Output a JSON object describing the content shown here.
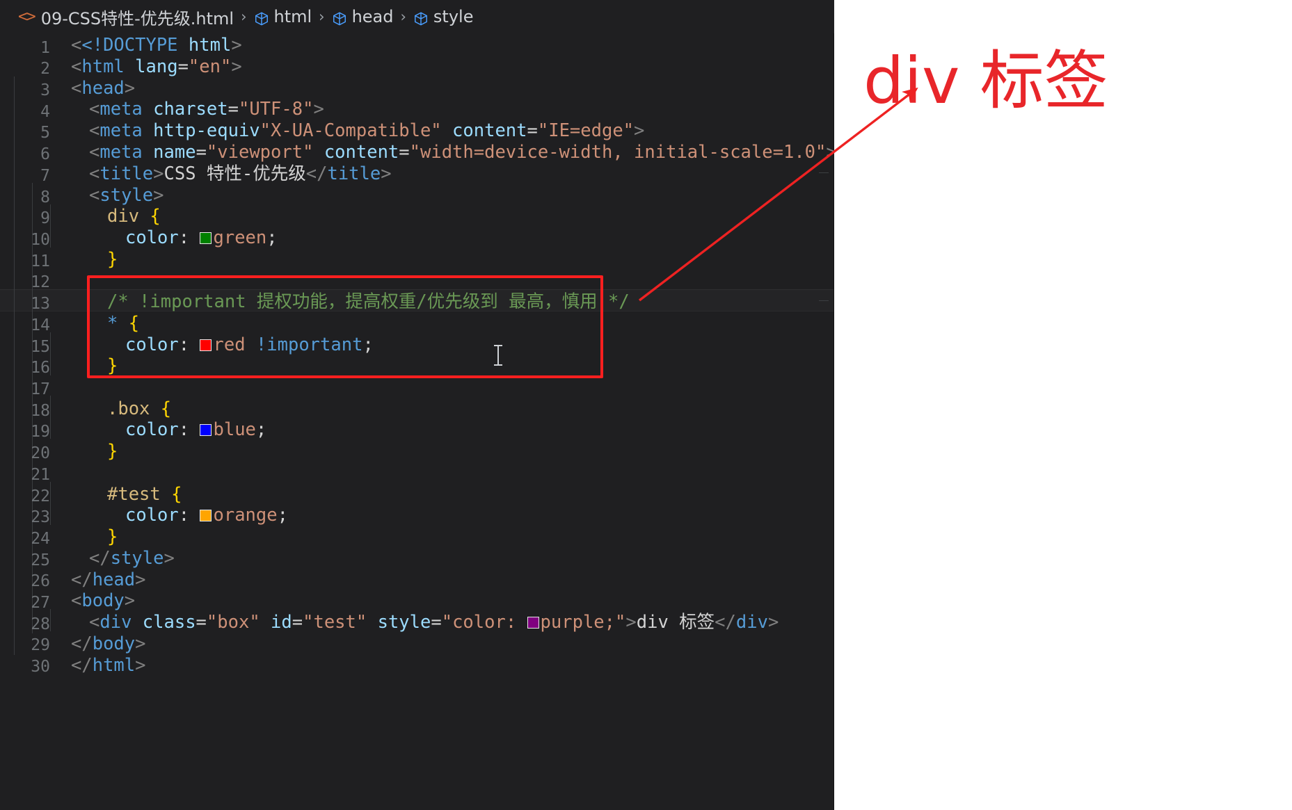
{
  "window": {
    "background": "#1f1f21",
    "accent_red": "#ff1f1f"
  },
  "breadcrumb": {
    "code_icon": "<>",
    "file_name": "09-CSS特性-优先级.html",
    "separator": "›",
    "items": [
      {
        "icon": "cube-icon",
        "label": "html"
      },
      {
        "icon": "cube-icon",
        "label": "head"
      },
      {
        "icon": "cube-icon",
        "label": "style"
      }
    ]
  },
  "editor": {
    "language": "html",
    "line_numbers": [
      1,
      2,
      3,
      4,
      5,
      6,
      7,
      8,
      9,
      10,
      11,
      12,
      13,
      14,
      15,
      16,
      17,
      18,
      19,
      20,
      21,
      22,
      23,
      24,
      25,
      26,
      27,
      28,
      29,
      30
    ],
    "lines": [
      {
        "n": 1,
        "text": "<!DOCTYPE html>"
      },
      {
        "n": 2,
        "text": "<html lang=\"en\">"
      },
      {
        "n": 3,
        "text": "<head>"
      },
      {
        "n": 4,
        "text": "  <meta charset=\"UTF-8\">"
      },
      {
        "n": 5,
        "text": "  <meta http-equiv=\"X-UA-Compatible\" content=\"IE=edge\">"
      },
      {
        "n": 6,
        "text": "  <meta name=\"viewport\" content=\"width=device-width, initial-scale=1.0\">"
      },
      {
        "n": 7,
        "text": "  <title>CSS 特性-优先级</title>"
      },
      {
        "n": 8,
        "text": "  <style>"
      },
      {
        "n": 9,
        "text": "    div {"
      },
      {
        "n": 10,
        "text": "      color: green;"
      },
      {
        "n": 11,
        "text": "    }"
      },
      {
        "n": 12,
        "text": ""
      },
      {
        "n": 13,
        "text": "    /* !important 提权功能，提高权重/优先级到 最高，慎用 */"
      },
      {
        "n": 14,
        "text": "    * {"
      },
      {
        "n": 15,
        "text": "      color: red !important;"
      },
      {
        "n": 16,
        "text": "    }"
      },
      {
        "n": 17,
        "text": ""
      },
      {
        "n": 18,
        "text": "    .box {"
      },
      {
        "n": 19,
        "text": "      color: blue;"
      },
      {
        "n": 20,
        "text": "    }"
      },
      {
        "n": 21,
        "text": ""
      },
      {
        "n": 22,
        "text": "    #test {"
      },
      {
        "n": 23,
        "text": "      color: orange;"
      },
      {
        "n": 24,
        "text": "    }"
      },
      {
        "n": 25,
        "text": "  </style>"
      },
      {
        "n": 26,
        "text": "</head>"
      },
      {
        "n": 27,
        "text": "<body>"
      },
      {
        "n": 28,
        "text": "  <div class=\"box\" id=\"test\" style=\"color: purple;\">div 标签</div>"
      },
      {
        "n": 29,
        "text": "</body>"
      },
      {
        "n": 30,
        "text": "</html>"
      }
    ],
    "tokens": {
      "l1_doctype": "<!DOCTYPE",
      "l1_name": "html",
      "l1_close": ">",
      "l2_open": "<",
      "l2_tag": "html",
      "l2_attr": "lang",
      "l2_eq": "=",
      "l2_val": "\"en\"",
      "l2_close": ">",
      "l3": "<head>",
      "l3_open": "<",
      "l3_tag": "head",
      "l3_close": ">",
      "l4_open": "<",
      "l4_tag": "meta",
      "l4_attr": "charset",
      "l4_eq": "=",
      "l4_val": "\"UTF-8\"",
      "l4_close": ">",
      "l5_open": "<",
      "l5_tag": "meta",
      "l5_attr1": "http-equiv",
      "l5_val1": "\"X-UA-Compatible\"",
      "l5_attr2": "content",
      "l5_val2": "\"IE=edge\"",
      "l5_close": ">",
      "l6_open": "<",
      "l6_tag": "meta",
      "l6_attr1": "name",
      "l6_val1": "\"viewport\"",
      "l6_attr2": "content",
      "l6_val2": "\"width=device-width, initial-scale=1.0\"",
      "l6_close": ">",
      "l7_open": "<",
      "l7_tag": "title",
      "l7_gt": ">",
      "l7_text": "CSS 特性-优先级",
      "l7_endopen": "</",
      "l7_endtag": "title",
      "l7_endgt": ">",
      "l8_open": "<",
      "l8_tag": "style",
      "l8_gt": ">",
      "l9_sel": "div",
      "l9_brace": "{",
      "l10_prop": "color",
      "l10_colon": ":",
      "l10_val": "green",
      "l10_semi": ";",
      "l10_swatch": "#008000",
      "l11_brace": "}",
      "l13_comment": "/* !important 提权功能，提高权重/优先级到 最高，慎用 */",
      "l14_sel": "*",
      "l14_brace": "{",
      "l15_prop": "color",
      "l15_colon": ":",
      "l15_val": "red",
      "l15_important": "!important",
      "l15_semi": ";",
      "l15_swatch": "#ff0000",
      "l16_brace": "}",
      "l18_sel": ".box",
      "l18_brace": "{",
      "l19_prop": "color",
      "l19_colon": ":",
      "l19_val": "blue",
      "l19_semi": ";",
      "l19_swatch": "#0000ff",
      "l20_brace": "}",
      "l22_sel": "#test",
      "l22_brace": "{",
      "l23_prop": "color",
      "l23_colon": ":",
      "l23_val": "orange",
      "l23_semi": ";",
      "l23_swatch": "#ffa500",
      "l24_brace": "}",
      "l25_endopen": "</",
      "l25_tag": "style",
      "l25_gt": ">",
      "l26_endopen": "</",
      "l26_tag": "head",
      "l26_gt": ">",
      "l27_open": "<",
      "l27_tag": "body",
      "l27_gt": ">",
      "l28_open": "<",
      "l28_tag": "div",
      "l28_attr1": "class",
      "l28_val1": "\"box\"",
      "l28_attr2": "id",
      "l28_val2": "\"test\"",
      "l28_attr3": "style",
      "l28_val3a": "\"color: ",
      "l28_val3b": "purple;\"",
      "l28_swatch": "#800080",
      "l28_gt": ">",
      "l28_text": "div 标签",
      "l28_endopen": "</",
      "l28_endtag": "div",
      "l28_endgt": ">",
      "l29_endopen": "</",
      "l29_tag": "body",
      "l29_gt": ">",
      "l30_endopen": "</",
      "l30_tag": "html",
      "l30_gt": ">"
    }
  },
  "annotations": {
    "highlight_box": {
      "label": "important-rule-highlight",
      "color": "#ff1f1f"
    },
    "arrow": {
      "label": "callout-arrow",
      "color": "#ee2222"
    }
  },
  "preview": {
    "background": "#ffffff",
    "rendered_text": "div 标签",
    "rendered_color": "#e8262a"
  }
}
